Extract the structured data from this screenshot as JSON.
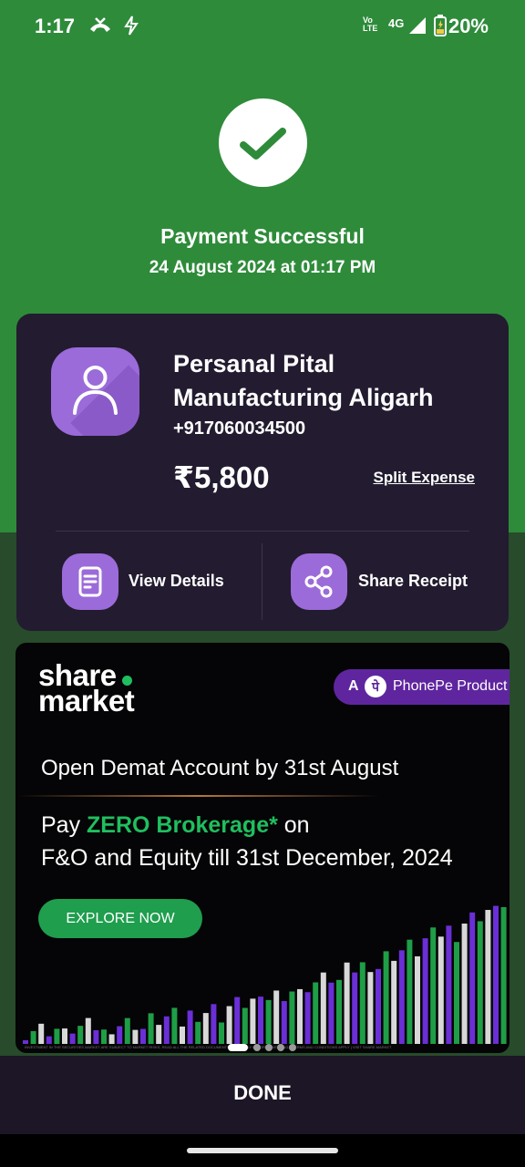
{
  "status_bar": {
    "time": "1:17",
    "volte": "Vo LTE",
    "network": "4G",
    "battery": "20%",
    "icons": [
      "missed-call-icon",
      "charging-bolt-icon",
      "signal-icon",
      "battery-icon"
    ]
  },
  "result": {
    "title": "Payment Successful",
    "datetime": "24 August 2024 at 01:17 PM",
    "icon": "checkmark-icon"
  },
  "payee": {
    "name": "Persanal Pital Manufacturing Aligarh",
    "phone": "+917060034500",
    "amount": "₹5,800",
    "split_label": "Split Expense",
    "avatar_icon": "person-icon"
  },
  "actions": {
    "view_details": "View Details",
    "share_receipt": "Share Receipt"
  },
  "ad": {
    "brand_line1": "share",
    "brand_line2": "market",
    "badge_prefix": "A",
    "badge_logo": "पे",
    "badge_text": "PhonePe Product",
    "headline": "Open Demat Account by 31st August",
    "pay_prefix": "Pay ",
    "pay_highlight": "ZERO Brokerage*",
    "pay_suffix": " on",
    "offer_line": "F&O and Equity till 31st December, 2024",
    "cta": "EXPLORE NOW",
    "fine_print": "INVESTMENT IN THE SECURITIES MARKET ARE SUBJECT TO MARKET RISKS, READ ALL THE RELATED DOCUMENTS CAREFULLY BEFORE INVESTING. | TERMS AND CONDITIONS APPLY | VISIT SHARE.MARKET",
    "carousel_pages": 5,
    "carousel_active": 0,
    "accent_green": "#1fbf5f",
    "accent_purple": "#5f259f"
  },
  "footer": {
    "done": "DONE"
  }
}
